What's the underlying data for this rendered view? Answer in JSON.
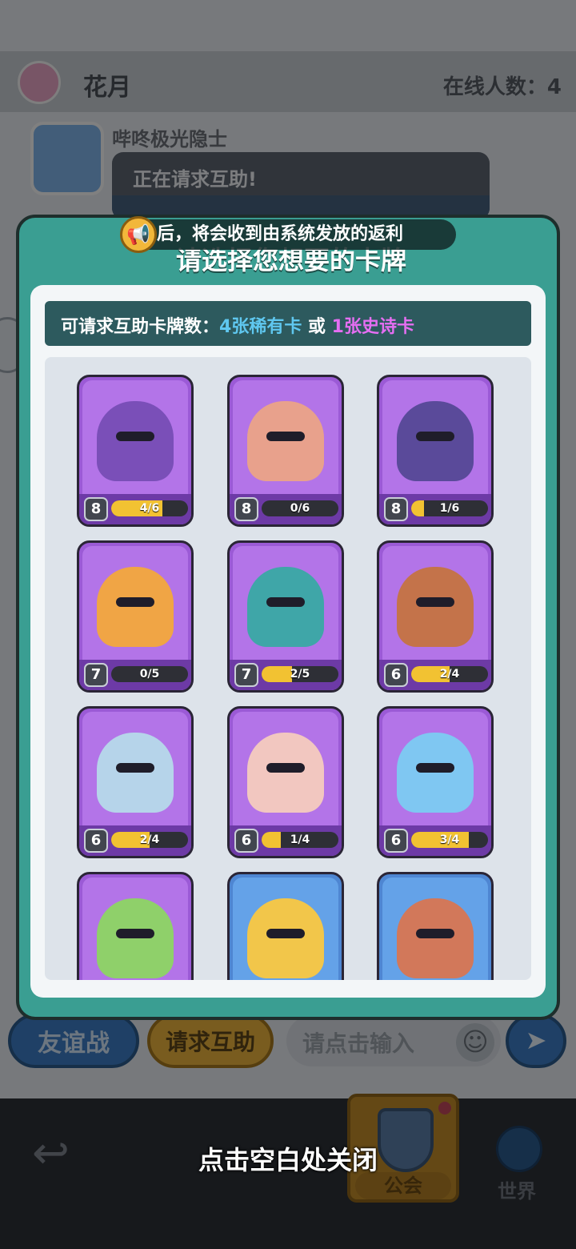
{
  "header": {
    "guild_name": "花月",
    "online_label": "在线人数：4"
  },
  "chat": {
    "username": "哔咚极光隐士",
    "message": "正在请求互助!"
  },
  "input_bar": {
    "friendly_battle": "友谊战",
    "request_help": "请求互助",
    "input_placeholder": "请点击输入"
  },
  "bottom_nav": {
    "guild_label": "公会",
    "world_label": "世界"
  },
  "close_hint": "点击空白处关闭",
  "modal": {
    "title": "请选择您想要的卡牌",
    "notice": "后，将会收到由系统发放的返利",
    "info": {
      "prefix": "可请求互助卡牌数：",
      "rare": "4张稀有卡",
      "middle": " 或 ",
      "epic": "1张史诗卡"
    }
  },
  "cards": [
    {
      "level": "8",
      "progress_text": "4/6",
      "progress": 0.667,
      "rarity": "epic",
      "skin": "#7a4fb8"
    },
    {
      "level": "8",
      "progress_text": "0/6",
      "progress": 0,
      "rarity": "epic",
      "skin": "#e8a18c"
    },
    {
      "level": "8",
      "progress_text": "1/6",
      "progress": 0.167,
      "rarity": "epic",
      "skin": "#5a4a9a"
    },
    {
      "level": "7",
      "progress_text": "0/5",
      "progress": 0,
      "rarity": "epic",
      "skin": "#f0a545"
    },
    {
      "level": "7",
      "progress_text": "2/5",
      "progress": 0.4,
      "rarity": "epic",
      "skin": "#3fa6a8"
    },
    {
      "level": "6",
      "progress_text": "2/4",
      "progress": 0.5,
      "rarity": "epic",
      "skin": "#c4734a"
    },
    {
      "level": "6",
      "progress_text": "2/4",
      "progress": 0.5,
      "rarity": "epic",
      "skin": "#b6d4ea"
    },
    {
      "level": "6",
      "progress_text": "1/4",
      "progress": 0.25,
      "rarity": "epic",
      "skin": "#f2c7c0"
    },
    {
      "level": "6",
      "progress_text": "3/4",
      "progress": 0.75,
      "rarity": "epic",
      "skin": "#7fc7f2"
    },
    {
      "level": "",
      "progress_text": "",
      "progress": 0,
      "rarity": "epic",
      "skin": "#8fd06a"
    },
    {
      "level": "",
      "progress_text": "",
      "progress": 0,
      "rarity": "rare",
      "skin": "#f2c64a"
    },
    {
      "level": "",
      "progress_text": "",
      "progress": 0,
      "rarity": "rare",
      "skin": "#d2785a"
    }
  ]
}
